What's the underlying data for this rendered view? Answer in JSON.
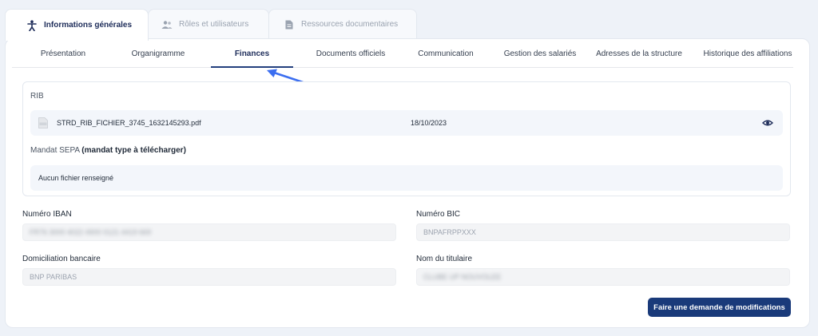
{
  "top_tabs": [
    {
      "label": "Informations générales",
      "icon": "person-icon",
      "active": true
    },
    {
      "label": "Rôles et utilisateurs",
      "icon": "users-icon",
      "active": false
    },
    {
      "label": "Ressources documentaires",
      "icon": "document-icon",
      "active": false
    }
  ],
  "sub_tabs": [
    {
      "label": "Présentation"
    },
    {
      "label": "Organigramme"
    },
    {
      "label": "Finances",
      "active": true
    },
    {
      "label": "Documents officiels"
    },
    {
      "label": "Communication"
    },
    {
      "label": "Gestion des salariés"
    },
    {
      "label": "Adresses de la structure"
    },
    {
      "label": "Historique des affiliations"
    }
  ],
  "rib": {
    "label": "RIB",
    "file_name": "STRD_RIB_FICHIER_3745_1632145293.pdf",
    "file_date": "18/10/2023",
    "view_icon": "eye-icon"
  },
  "sepa": {
    "label_prefix": "Mandat SEPA ",
    "label_bold": "(mandat type à télécharger)",
    "empty_text": "Aucun fichier renseigné"
  },
  "fields": {
    "iban": {
      "label": "Numéro IBAN",
      "value": "FR76 3000 4022 4900 0121 4419 669"
    },
    "bic": {
      "label": "Numéro BIC",
      "value": "BNPAFRPPXXX"
    },
    "domiciliation": {
      "label": "Domiciliation bancaire",
      "value": "BNP PARIBAS"
    },
    "titulaire": {
      "label": "Nom du titulaire",
      "value": "CLUBE UP NOUVOLEE"
    }
  },
  "actions": {
    "request_changes": "Faire une demande de modifications"
  },
  "colors": {
    "accent": "#1a3a7a",
    "arrow": "#3b6ef0",
    "background": "#eef2f8"
  }
}
